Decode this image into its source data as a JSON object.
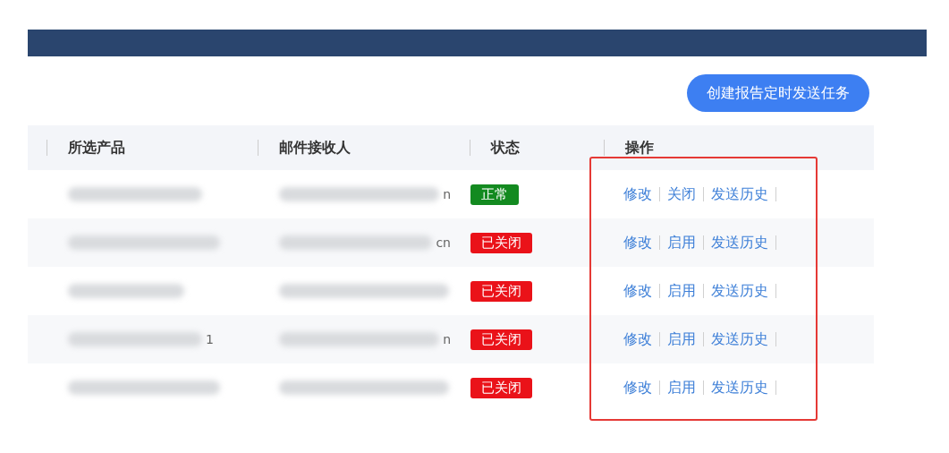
{
  "create_button": "创建报告定时发送任务",
  "table": {
    "columns": [
      "所选产品",
      "邮件接收人",
      "状态",
      "操作"
    ],
    "rows": [
      {
        "product": {
          "redacted": true
        },
        "recipient": {
          "redacted": true,
          "fragment": "n"
        },
        "status": {
          "label": "正常",
          "kind": "normal"
        },
        "actions": [
          "修改",
          "关闭",
          "发送历史"
        ]
      },
      {
        "product": {
          "redacted": true
        },
        "recipient": {
          "redacted": true,
          "fragment": "cn"
        },
        "status": {
          "label": "已关闭",
          "kind": "closed"
        },
        "actions": [
          "修改",
          "启用",
          "发送历史"
        ]
      },
      {
        "product": {
          "redacted": true
        },
        "recipient": {
          "redacted": true
        },
        "status": {
          "label": "已关闭",
          "kind": "closed"
        },
        "actions": [
          "修改",
          "启用",
          "发送历史"
        ]
      },
      {
        "product": {
          "redacted": true,
          "fragment": "1"
        },
        "recipient": {
          "redacted": true,
          "fragment": "n"
        },
        "status": {
          "label": "已关闭",
          "kind": "closed"
        },
        "actions": [
          "修改",
          "启用",
          "发送历史"
        ]
      },
      {
        "product": {
          "redacted": true
        },
        "recipient": {
          "redacted": true
        },
        "status": {
          "label": "已关闭",
          "kind": "closed"
        },
        "actions": [
          "修改",
          "启用",
          "发送历史"
        ]
      }
    ]
  }
}
